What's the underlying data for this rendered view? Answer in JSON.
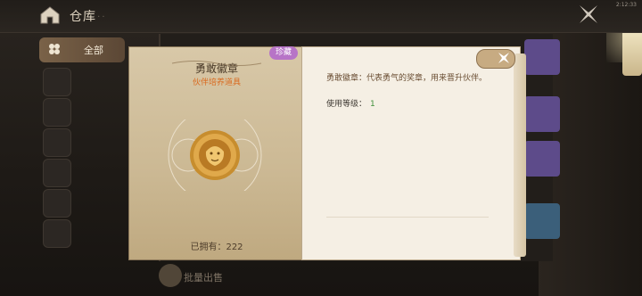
{
  "header": {
    "title": "仓库",
    "clock": "2:12:33"
  },
  "sidebar": {
    "active_label": "全部"
  },
  "bottom": {
    "batch_sell_label": "批量出售"
  },
  "dialog": {
    "rarity_badge": "珍藏",
    "item_name": "勇敢徽章",
    "item_type": "伙伴培养道具",
    "owned_text": "已拥有：222",
    "description": "勇敢徽章：代表勇气的奖章，用来晋升伙伴。",
    "level_label": "使用等级：",
    "level_value": "1"
  },
  "colors": {
    "rarity": "#b774c7",
    "item_type": "#d96a1f",
    "level_value": "#3f8f3a"
  },
  "icons": [
    "home-icon",
    "close-x-icon",
    "medal-lion-icon",
    "coin-icon"
  ]
}
